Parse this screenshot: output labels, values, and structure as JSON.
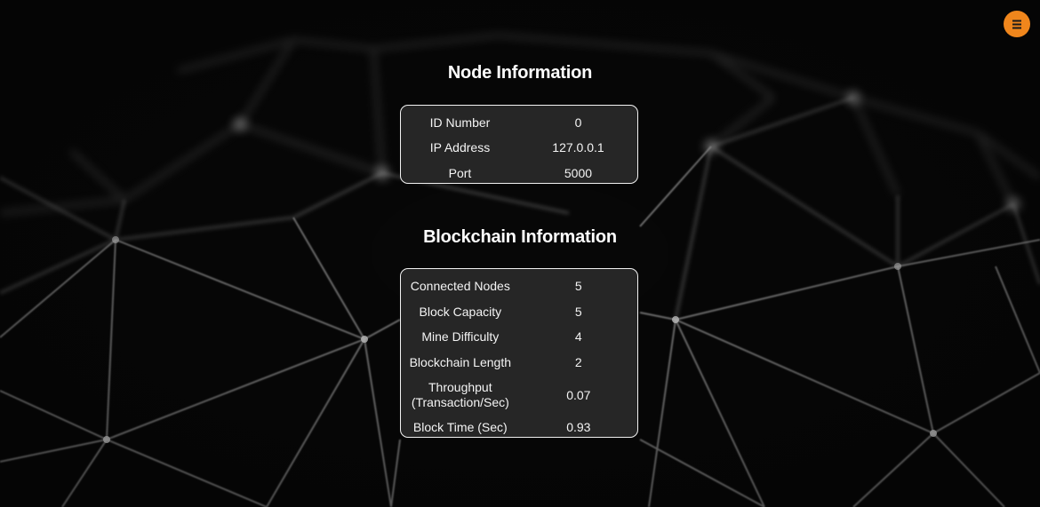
{
  "menu": {
    "icon": "hamburger-menu-icon",
    "accent_color": "#f0861c"
  },
  "node_section": {
    "title": "Node Information",
    "rows": [
      {
        "label": "ID Number",
        "value": "0"
      },
      {
        "label": "IP Address",
        "value": "127.0.0.1"
      },
      {
        "label": "Port",
        "value": "5000"
      }
    ]
  },
  "blockchain_section": {
    "title": "Blockchain Information",
    "rows": [
      {
        "label": "Connected Nodes",
        "value": "5"
      },
      {
        "label": "Block Capacity",
        "value": "5"
      },
      {
        "label": "Mine Difficulty",
        "value": "4"
      },
      {
        "label": "Blockchain Length",
        "value": "2"
      },
      {
        "label_line1": "Throughput",
        "label_line2": "(Transaction/Sec)",
        "value": "0.07"
      },
      {
        "label": "Block Time (Sec)",
        "value": "0.93"
      }
    ]
  }
}
